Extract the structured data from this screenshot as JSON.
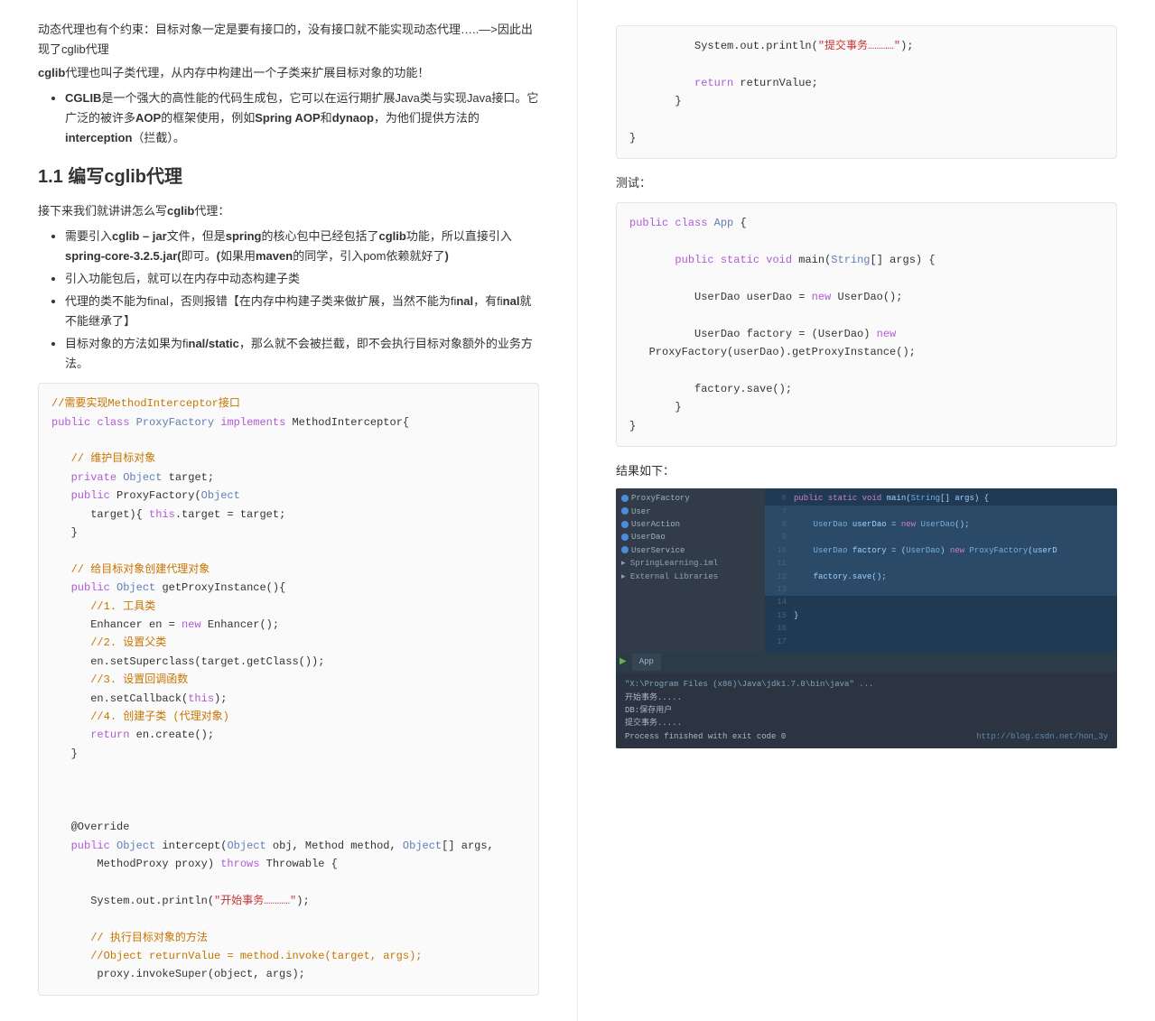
{
  "left": {
    "intro1": "动态代理也有个约束：目标对象一定是要有接口的，没有接口就不能实现动态代理…..—>因此出现了cglib代理",
    "intro2_a": "cglib",
    "intro2_b": "代理也叫子类代理，从内存中构建出一个子类来扩展目标对象的功能！",
    "li1_a": "CGLIB",
    "li1_b": "是一个强大的高性能的代码生成包，它可以在运行期扩展Java类与实现Java接口。它广泛的被许多",
    "li1_c": "AOP",
    "li1_d": "的框架使用，例如",
    "li1_e": "Spring AOP",
    "li1_f": "和",
    "li1_g": "dynaop",
    "li1_h": "，为他们提供方法的",
    "li1_i": "interception",
    "li1_j": "（拦截）。",
    "h2": "1.1 编写cglib代理",
    "p2_a": "接下来我们就讲讲怎么写",
    "p2_b": "cglib",
    "p2_c": "代理：",
    "li2_a": "需要引入",
    "li2_b": "cglib – jar",
    "li2_c": "文件，但是",
    "li2_d": "spring",
    "li2_e": "的核心包中已经包括了",
    "li2_f": "cglib",
    "li2_g": "功能，所以直接引入",
    "li2_h": "spring-core-3.2.5.jar",
    "li2_i": "即可。",
    "li2_j": "(",
    "li2_k": "如果用",
    "li2_l": "maven",
    "li2_m": "的同学，引入pom依赖就好了",
    "li2_n": ")",
    "li3": "引入功能包后，就可以在内存中动态构建子类",
    "li4_a": "代理的类不能为final，否则报错【在内存中构建子类来做扩展，当然不能为fi",
    "li4_b": "nal",
    "li4_c": "，有fi",
    "li4_d": "nal",
    "li4_e": "就不能继承了】",
    "li5_a": "目标对象的方法如果为fi",
    "li5_b": "nal/static",
    "li5_c": "，那么就不会被拦截，即不会执行目标对象额外的业务方法。",
    "code1": {
      "c1": "//需要实现MethodInterceptor接口",
      "l2a": "public",
      "l2b": "class",
      "l2c": "ProxyFactory",
      "l2d": "implements",
      "l2e": " MethodInterceptor{",
      "c3": "// 维护目标对象",
      "l4a": "private",
      "l4b": "Object",
      "l4c": " target;",
      "l5a": "public",
      "l5b": " ProxyFactory(",
      "l5c": "Object",
      "l6a": "      target){ ",
      "l6b": "this",
      "l6c": ".target = target;",
      "l7": "   }",
      "c8": "// 给目标对象创建代理对象",
      "l9a": "public",
      "l9b": "Object",
      "l9c": " getProxyInstance(){",
      "c10": "//1. 工具类",
      "l11a": "      Enhancer en = ",
      "l11b": "new",
      "l11c": " Enhancer();",
      "c12": "//2. 设置父类",
      "l13": "      en.setSuperclass(target.getClass());",
      "c14": "//3. 设置回调函数",
      "l15a": "      en.setCallback(",
      "l15b": "this",
      "l15c": ");",
      "c16": "//4. 创建子类 (代理对象)",
      "l17a": "return",
      "l17b": " en.create();",
      "l18": "   }",
      "l19": "   @Override",
      "l20a": "public",
      "l20b": "Object",
      "l20c": " intercept(",
      "l20d": "Object",
      "l20e": " obj, Method method, ",
      "l20f": "Object",
      "l20g": "[] args,",
      "l21a": "       MethodProxy proxy) ",
      "l21b": "throws",
      "l21c": " Throwable {",
      "l22a": "      System.out.println(",
      "l22b": "\"开始事务…………\"",
      "l22c": ");",
      "c23": "// 执行目标对象的方法",
      "c24": "//Object returnValue = method.invoke(target, args);",
      "l25": "       proxy.invokeSuper(object, args);"
    }
  },
  "right": {
    "code1": {
      "l1a": "          System.out.println(",
      "l1b": "\"提交事务…………\"",
      "l1c": ");",
      "l2a": "return",
      "l2b": " returnValue;",
      "l3": "       }",
      "l4": "}"
    },
    "label_test": "测试：",
    "code2": {
      "l1a": "public",
      "l1b": "class",
      "l1c": "App",
      "l1d": " {",
      "l2a": "public",
      "l2b": "static",
      "l2c": "void",
      "l2d": " main(",
      "l2e": "String",
      "l2f": "[] args) {",
      "l3a": "          UserDao userDao = ",
      "l3b": "new",
      "l3c": " UserDao();",
      "l4a": "          UserDao factory = (UserDao) ",
      "l4b": "new",
      "l5": "   ProxyFactory(userDao).getProxyInstance();",
      "l6": "          factory.save();",
      "l7": "       }",
      "l8": "}"
    },
    "label_result": "结果如下：",
    "ide": {
      "tree": [
        "ProxyFactory",
        "User",
        "UserAction",
        "UserDao",
        "UserService"
      ],
      "tree_file1": "SpringLearning.iml",
      "tree_file2": "External Libraries",
      "editor": [
        {
          "n": "6",
          "t": "public static void main(String[] args) {",
          "hl": false
        },
        {
          "n": "7",
          "t": "",
          "hl": true
        },
        {
          "n": "8",
          "t": "    UserDao userDao = new UserDao();",
          "hl": true
        },
        {
          "n": "9",
          "t": "",
          "hl": true
        },
        {
          "n": "10",
          "t": "    UserDao factory = (UserDao) new ProxyFactory(userD",
          "hl": true
        },
        {
          "n": "11",
          "t": "",
          "hl": true
        },
        {
          "n": "12",
          "t": "    factory.save();",
          "hl": true
        },
        {
          "n": "13",
          "t": "",
          "hl": true
        },
        {
          "n": "14",
          "t": "",
          "hl": false
        },
        {
          "n": "15",
          "t": "}",
          "hl": false
        },
        {
          "n": "16",
          "t": "",
          "hl": false
        },
        {
          "n": "17",
          "t": "",
          "hl": false
        }
      ],
      "tab": "App",
      "console": [
        "\"X:\\Program Files (x86)\\Java\\jdk1.7.0\\bin\\java\" ...",
        "开始事务.....",
        "DB:保存用户",
        "提交事务.....",
        "",
        "Process finished with exit code 0"
      ],
      "url": "http://blog.csdn.net/hon_3y"
    }
  }
}
